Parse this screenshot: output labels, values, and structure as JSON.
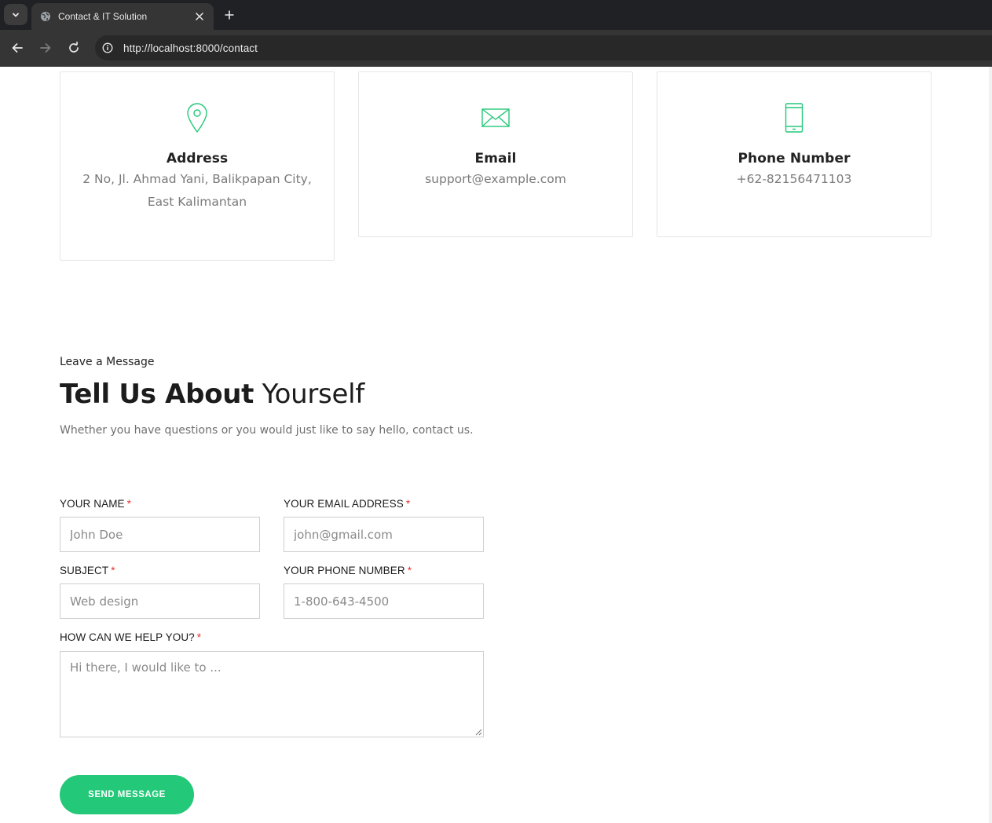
{
  "browser": {
    "tab_title": "Contact & IT Solution",
    "url": "http://localhost:8000/contact"
  },
  "contact_cards": [
    {
      "icon": "map-pin-icon",
      "title": "Address",
      "lines": [
        "2 No, Jl. Ahmad Yani, Balikpapan City,",
        "East Kalimantan"
      ]
    },
    {
      "icon": "envelope-icon",
      "title": "Email",
      "lines": [
        "support@example.com"
      ]
    },
    {
      "icon": "phone-icon",
      "title": "Phone Number",
      "lines": [
        "+62-82156471103"
      ]
    }
  ],
  "form_section": {
    "eyebrow": "Leave a Message",
    "heading_strong": "Tell Us About",
    "heading_light": "Yourself",
    "subtext": "Whether you have questions or you would just like to say hello, contact us."
  },
  "form": {
    "name": {
      "label": "YOUR NAME",
      "placeholder": "John Doe"
    },
    "email": {
      "label": "YOUR EMAIL ADDRESS",
      "placeholder": "john@gmail.com"
    },
    "subject": {
      "label": "SUBJECT",
      "placeholder": "Web design"
    },
    "phone": {
      "label": "YOUR PHONE NUMBER",
      "placeholder": "1-800-643-4500"
    },
    "message": {
      "label": "HOW CAN WE HELP YOU?",
      "placeholder": "Hi there, I would like to ..."
    },
    "required_mark": "*",
    "submit_label": "SEND MESSAGE"
  },
  "colors": {
    "accent": "#23c878",
    "required": "#e3342f"
  }
}
